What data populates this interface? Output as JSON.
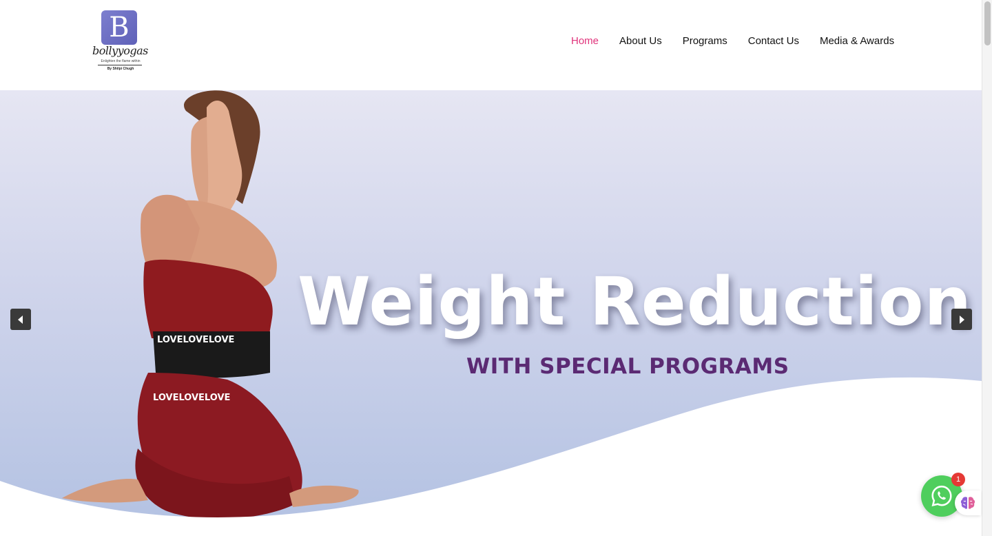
{
  "logo": {
    "letter": "B",
    "name": "bollyyogas",
    "tagline": "Enlighten the flame within",
    "byline": "By Shilpi Chugh"
  },
  "nav": {
    "items": [
      {
        "label": "Home",
        "active": true
      },
      {
        "label": "About Us",
        "active": false
      },
      {
        "label": "Programs",
        "active": false
      },
      {
        "label": "Contact Us",
        "active": false
      },
      {
        "label": "Media & Awards",
        "active": false
      }
    ]
  },
  "hero": {
    "title": "Weight Reduction",
    "subtitle": "WITH SPECIAL PROGRAMS",
    "belt_text": "LOVELOVELOVE"
  },
  "widgets": {
    "whatsapp_badge": "1",
    "whatsapp_icon": "whatsapp-icon",
    "brain_icon": "brain-icon"
  },
  "colors": {
    "nav_active": "#e0337b",
    "subtitle": "#5b2a73",
    "whatsapp": "#4fce5d",
    "logo_badge": "#6f71c4"
  }
}
